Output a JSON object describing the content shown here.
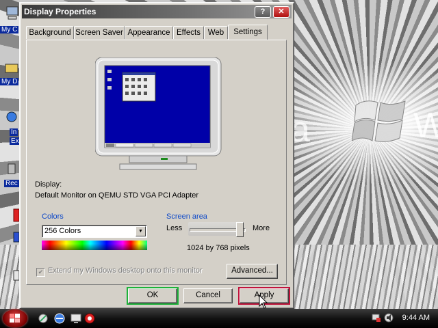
{
  "desktop": {
    "icon_labels": [
      "My C",
      "My D",
      "In",
      "Ex",
      "Rec"
    ],
    "brand_letters": [
      "a",
      "W"
    ]
  },
  "dialog": {
    "title": "Display Properties",
    "help_glyph": "?",
    "close_glyph": "✕",
    "tabs": [
      {
        "label": "Background"
      },
      {
        "label": "Screen Saver"
      },
      {
        "label": "Appearance"
      },
      {
        "label": "Effects"
      },
      {
        "label": "Web"
      },
      {
        "label": "Settings",
        "active": true
      }
    ],
    "display_label": "Display:",
    "display_value": "Default Monitor on QEMU STD VGA PCI Adapter",
    "colors": {
      "label": "Colors",
      "selected": "256 Colors",
      "arrow_glyph": "▼"
    },
    "screen_area": {
      "label": "Screen area",
      "less": "Less",
      "more": "More",
      "resolution": "1024 by 768 pixels",
      "slider_level": 1.0
    },
    "extend_checkbox": {
      "label": "Extend my Windows desktop onto this monitor",
      "checked": true,
      "enabled": false
    },
    "advanced_button": "Advanced...",
    "ok_button": "OK",
    "cancel_button": "Cancel",
    "apply_button": "Apply"
  },
  "taskbar": {
    "time": "9:44 AM"
  },
  "colors": {
    "dialog_face": "#d4d0c8",
    "group_label": "#0a46c8",
    "preview_screen": "#0000a8",
    "ok_focus": "#1eb23a",
    "apply_focus": "#c0143c"
  }
}
